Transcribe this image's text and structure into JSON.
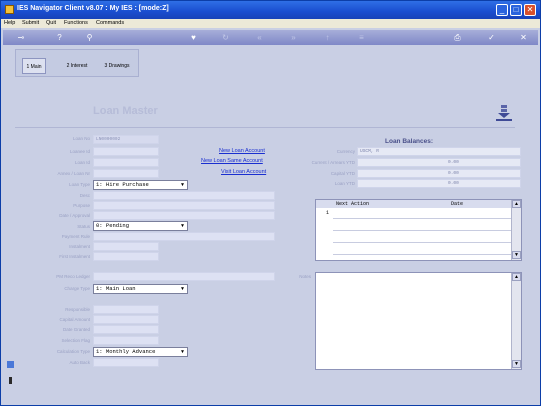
{
  "window": {
    "title": "IES Navigator Client v8.07 : My IES :      [mode:Z]",
    "controls": {
      "minimize": "_",
      "maximize": "□",
      "close": "✕"
    }
  },
  "menu": {
    "items": [
      "Help",
      "Submit",
      "Quit",
      "Functions",
      "Commands"
    ]
  },
  "toolbar": {
    "icons": [
      "key-icon",
      "help-icon",
      "search-icon",
      "heart-icon",
      "refresh-icon",
      "rewind-icon",
      "forward-icon",
      "up-icon",
      "list-icon",
      "print-icon",
      "check-icon",
      "close-icon"
    ]
  },
  "tabs": [
    {
      "label": "1 Main"
    },
    {
      "label": "2 Interest"
    },
    {
      "label": "3 Drawings"
    }
  ],
  "form": {
    "title": "Loan Master",
    "labels": {
      "loan_no": "Loan No",
      "loanee_id": "Loanee Id",
      "loan_id": "Loan Id",
      "annex_loan": "Annex / Loan Nr",
      "loan_type": "Loan Type",
      "desc": "Desc",
      "purpose": "Purpose",
      "date_approval": "Date / Approval",
      "status": "Status",
      "payment_rule": "Payment Rule",
      "instalment": "Instalment",
      "first_instalment": "First Instalment",
      "pm_reco_ledger": "PM Reco Ledger",
      "charge_type": "Charge Type",
      "responsible": "Responsible",
      "capital_amount": "Capital Amount",
      "date_granted": "Date Granted",
      "selection_flag": "Selection Flag",
      "calculation_type": "Calculation Type",
      "auto_back": "Auto Back"
    },
    "values": {
      "loan_no": "LN0000002",
      "loan_type": "1: Hire Purchase",
      "status": "0: Pending",
      "charge_type": "1: Main Loan",
      "calculation_type": "1: Monthly Advance"
    }
  },
  "links": {
    "new_loan_account": "New Loan Account",
    "new_loan_same_account": "New Loan Same Account",
    "visit_loan_account": "Visit Loan Account"
  },
  "balances": {
    "title": "Loan Balances:",
    "labels": {
      "currency": "Currency",
      "current_arrears": "Current / Arrears YTD",
      "capital_ytd": "Capital YTD",
      "loan_ytd": "Loan YTD"
    },
    "values": {
      "currency": "USCM, R",
      "current_arrears": "0.00",
      "capital_ytd": "0.00",
      "loan_ytd": "0.00"
    }
  },
  "grid": {
    "headers": {
      "next_action": "Next Action",
      "date": "Date"
    },
    "row_number": "1"
  },
  "notes": {
    "label": "Notes"
  }
}
